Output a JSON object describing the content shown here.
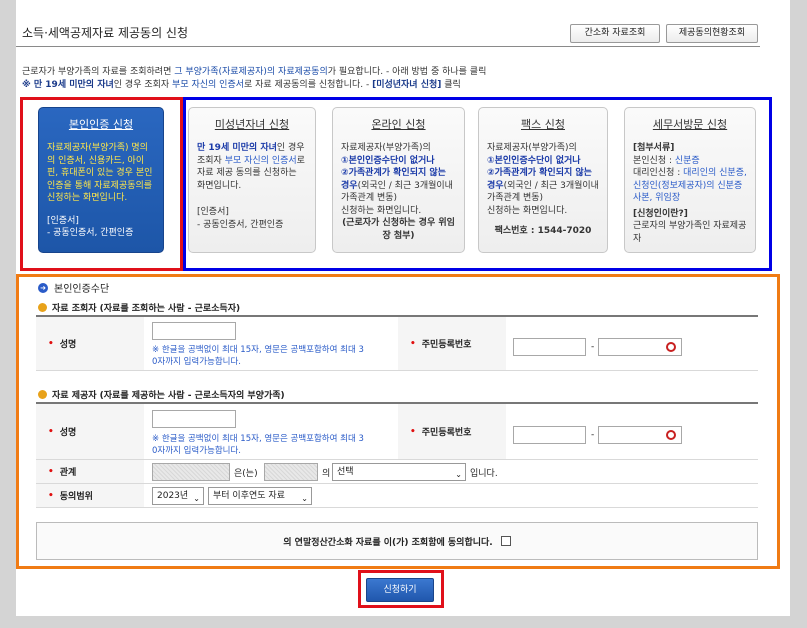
{
  "header": {
    "title": "소득·세액공제자료 제공동의 신청",
    "btn_simple": "간소화 자료조회",
    "btn_status": "제공동의현황조회"
  },
  "intro": {
    "l1_a": "근로자가 부양가족의 자료를 조회하려면 ",
    "l1_b": "그 부양가족(자료제공자)의 자료제공동의",
    "l1_c": "가 필요합니다. - 아래 방법 중 하나를 클릭",
    "l2_a": "※ 만 19세 미만의 자녀",
    "l2_b": "인 경우 조회자 ",
    "l2_c": "부모 자신의 인증서",
    "l2_d": "로 자료 제공동의를 신청합니다. - ",
    "l2_e": "[미성년자녀 신청]",
    "l2_f": " 클릭"
  },
  "cards": {
    "self": {
      "title": "본인인증 신청",
      "desc": "자료제공자(부양가족) 명의의 인증서, 신용카드, 아이핀, 휴대폰이 있는 경우 본인 인증을 통해 자료제공동의를 신청하는 화면입니다.",
      "cert_label": "[인증서]",
      "cert": "- 공동인증서, 간편인증"
    },
    "minor": {
      "title": "미성년자녀 신청",
      "d1": "만 19세 미만의 자녀",
      "d2": "인 경우 조회자 ",
      "d3": "부모 자신의 인증서",
      "d4": "로 자료 제공 동의를 신청하는 화면입니다.",
      "cert_label": "[인증서]",
      "cert": "- 공동인증서, 간편인증"
    },
    "online": {
      "title": "온라인 신청",
      "d1": "자료제공자(부양가족)의",
      "d2": "①본인인증수단이 없거나",
      "d3": "②가족관계가 확인되지 않는 경우",
      "d4": "(외국인 / 최근 3개월이내 가족관계 변동)",
      "d5": "신청하는 화면입니다.",
      "d6": "(근로자가 신청하는 경우 위임장 첨부)"
    },
    "fax": {
      "title": "팩스 신청",
      "d1": "자료제공자(부양가족)의",
      "d2": "①본인인증수단이 없거나",
      "d3": "②가족관계가 확인되지 않는 경우",
      "d4": "(외국인 / 최근 3개월이내 가족관계 변동)",
      "d5": "신청하는 화면입니다.",
      "fax_no": "팩스번호 : 1544-7020"
    },
    "visit": {
      "title": "세무서방문 신청",
      "docs_label": "[첨부서류]",
      "d1": "본인신청 : ",
      "d2": "신분증",
      "d3": "대리인신청 : ",
      "d4": "대리인의 신분증, 신청인(정보제공자)의 신분증 사본, 위임장",
      "q_label": "[신청인이란?]",
      "q_desc": "근로자의 부양가족인 자료제공자"
    }
  },
  "form": {
    "section_title": "본인인증수단",
    "viewer_head": "자료 조회자 (자료를 조회하는 사람 - 근로소득자)",
    "provider_head": "자료 제공자 (자료를 제공하는 사람 - 근로소득자의 부양가족)",
    "name_label": "성명",
    "rrn_label": "주민등록번호",
    "hint_1": "※ 한글을 공백없이 최대 15자, 영문은 공백포함하여 최대 3",
    "hint_2": "0자까지 입력가능합니다.",
    "dash": "-",
    "relation_label": "관계",
    "relation_eun": "은(는)",
    "relation_ui": "의",
    "relation_select": "선택",
    "relation_end": "입니다.",
    "range_label": "동의범위",
    "year": "2023년",
    "range_select": "부터 이후연도 자료",
    "agree_text": "의 연말정산간소화 자료를 이(가) 조회함에 동의합니다.",
    "apply": "신청하기"
  },
  "colors": {
    "primary": "#1d56a8",
    "highlight_red": "#e0101a",
    "highlight_blue": "#0000e6",
    "highlight_orange": "#f07b14"
  }
}
